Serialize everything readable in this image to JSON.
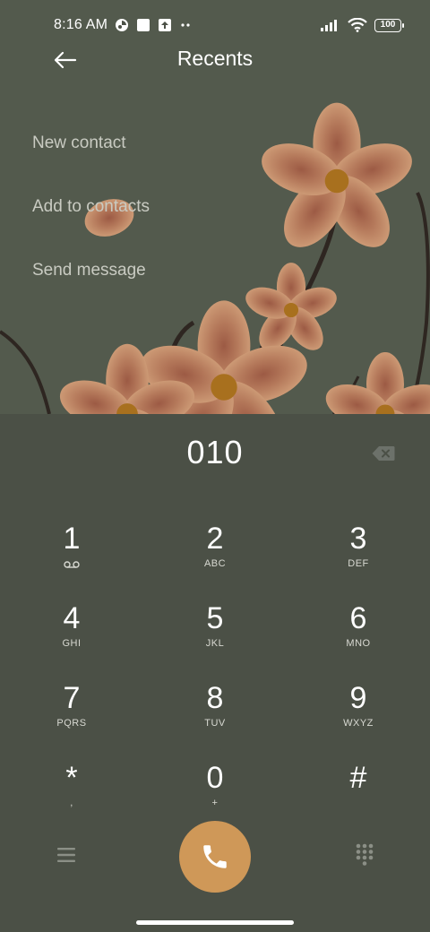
{
  "status_bar": {
    "time": "8:16 AM",
    "battery": "100",
    "icons": [
      "app-notification-icon",
      "blank-square-icon",
      "upload-icon",
      "more-dots-icon",
      "signal-icon",
      "wifi-icon",
      "battery-icon"
    ]
  },
  "header": {
    "title": "Recents",
    "back_icon": "arrow-left-icon"
  },
  "actions": [
    {
      "label": "New contact"
    },
    {
      "label": "Add to contacts"
    },
    {
      "label": "Send message"
    }
  ],
  "dialer": {
    "number": "010",
    "backspace_icon": "backspace-icon"
  },
  "keypad": {
    "keys": [
      {
        "digit": "1",
        "sub": "",
        "sub_icon": "voicemail-icon"
      },
      {
        "digit": "2",
        "sub": "ABC"
      },
      {
        "digit": "3",
        "sub": "DEF"
      },
      {
        "digit": "4",
        "sub": "GHI"
      },
      {
        "digit": "5",
        "sub": "JKL"
      },
      {
        "digit": "6",
        "sub": "MNO"
      },
      {
        "digit": "7",
        "sub": "PQRS"
      },
      {
        "digit": "8",
        "sub": "TUV"
      },
      {
        "digit": "9",
        "sub": "WXYZ"
      },
      {
        "digit": "*",
        "sub": ","
      },
      {
        "digit": "0",
        "sub": "+"
      },
      {
        "digit": "#",
        "sub": ""
      }
    ]
  },
  "bottom_bar": {
    "menu_icon": "menu-icon",
    "call_icon": "phone-icon",
    "dialpad_icon": "dialpad-icon"
  },
  "colors": {
    "background": "#4b5046",
    "wallpaper": "#535a4d",
    "call_button": "#cf9858",
    "action_text": "#c9cbc2"
  }
}
